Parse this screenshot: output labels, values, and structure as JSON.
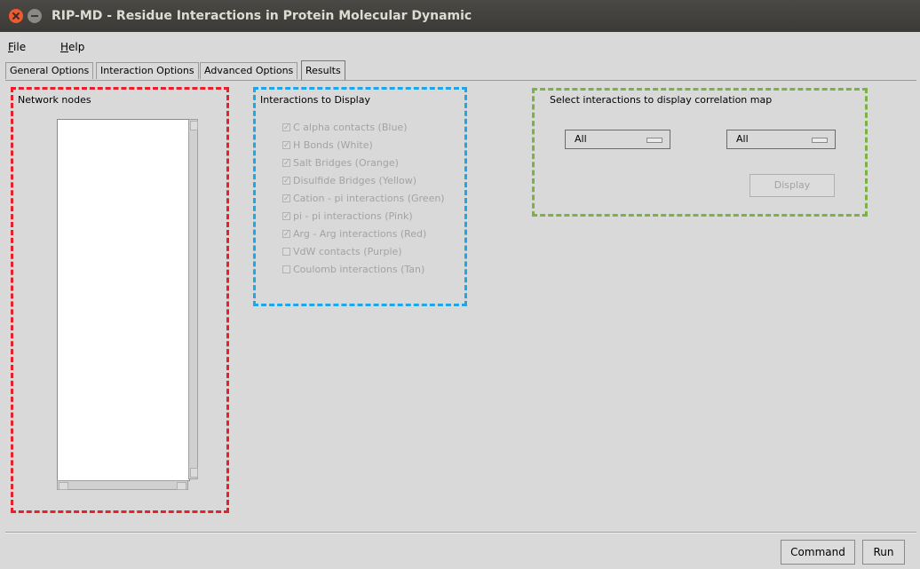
{
  "window": {
    "title": "RIP-MD - Residue Interactions in Protein Molecular Dynamic"
  },
  "menu": {
    "file_mnemonic": "F",
    "file_rest": "ile",
    "help_mnemonic": "H",
    "help_rest": "elp"
  },
  "tabs": [
    {
      "label": "General Options"
    },
    {
      "label": "Interaction Options"
    },
    {
      "label": "Advanced Options"
    },
    {
      "label": "Results"
    }
  ],
  "network_nodes": {
    "title": "Network nodes",
    "items": []
  },
  "interactions": {
    "title": "Interactions to Display",
    "items": [
      {
        "label": "C alpha contacts (Blue)",
        "checked": true
      },
      {
        "label": "H Bonds (White)",
        "checked": true
      },
      {
        "label": "Salt Bridges (Orange)",
        "checked": true
      },
      {
        "label": "Disulfide Bridges (Yellow)",
        "checked": true
      },
      {
        "label": "Cation - pi interactions (Green)",
        "checked": true
      },
      {
        "label": "pi - pi interactions (Pink)",
        "checked": true
      },
      {
        "label": "Arg - Arg interactions (Red)",
        "checked": true
      },
      {
        "label": "VdW contacts (Purple)",
        "checked": false
      },
      {
        "label": "Coulomb interactions (Tan)",
        "checked": false
      }
    ]
  },
  "correlation": {
    "title": "Select interactions to display correlation map",
    "select1": "All",
    "select2": "All",
    "display_button": "Display"
  },
  "footer": {
    "command_button": "Command",
    "run_button": "Run"
  },
  "colors": {
    "red_box": "#e8202a",
    "blue_box": "#1ea7e8",
    "green_box": "#7bb342"
  }
}
